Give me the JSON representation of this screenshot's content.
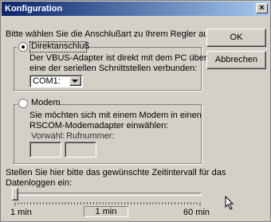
{
  "window": {
    "title": "Konfiguration",
    "close_glyph": "×"
  },
  "prompt": "Bitte wählen Sie die Anschlußart zu Ihrem Regler aus:",
  "buttons": {
    "ok": "OK",
    "cancel": "Abbrechen"
  },
  "direct": {
    "label": "Direktanschluß",
    "selected": true,
    "desc_line1": "Der VBUS-Adapter ist direkt mit dem PC über",
    "desc_line2": "eine der seriellen Schnittstellen verbunden:",
    "port_value": "COM1:"
  },
  "modem": {
    "label": "Modem",
    "selected": false,
    "desc_line1": "Sie möchten sich mit einem Modem in einen",
    "desc_line2": "RSCOM-Modemadapter einwählen:",
    "prefix_label": "Vorwahl:",
    "prefix_value": "",
    "number_label": "Rufnummer:",
    "number_value": ""
  },
  "interval": {
    "text_line1": "Stellen Sie hier bitte das gewünschte Zeitintervall für das",
    "text_line2": "Datenloggen ein:",
    "min_label": "1 min",
    "max_label": "60 min",
    "current_value": "1 min",
    "slider_fraction": 0.0
  }
}
